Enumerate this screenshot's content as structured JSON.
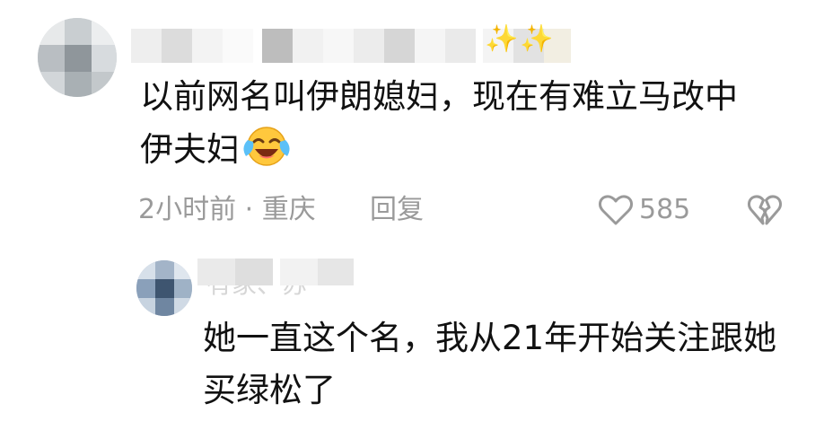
{
  "main_comment": {
    "username_sparkles": "✨✨",
    "text_line1": "以前网名叫伊朗媳妇，现在有难立马改中",
    "text_line2": "伊夫妇",
    "emoji": "laughing-with-tears-emoji",
    "time_location": "2小时前 · 重庆",
    "reply_label": "回复",
    "like_count": "585",
    "icons": {
      "like": "heart-outline-icon",
      "dislike": "broken-heart-icon"
    }
  },
  "reply_comment": {
    "username_partial": "有家、苏",
    "text_line1": "她一直这个名，我从21年开始关注跟她",
    "text_line2": "买绿松了"
  },
  "colors": {
    "text_primary": "#111111",
    "text_secondary": "#9a9a9a",
    "sparkle": "#f6d36c",
    "emoji_face": "#ffc83d"
  }
}
